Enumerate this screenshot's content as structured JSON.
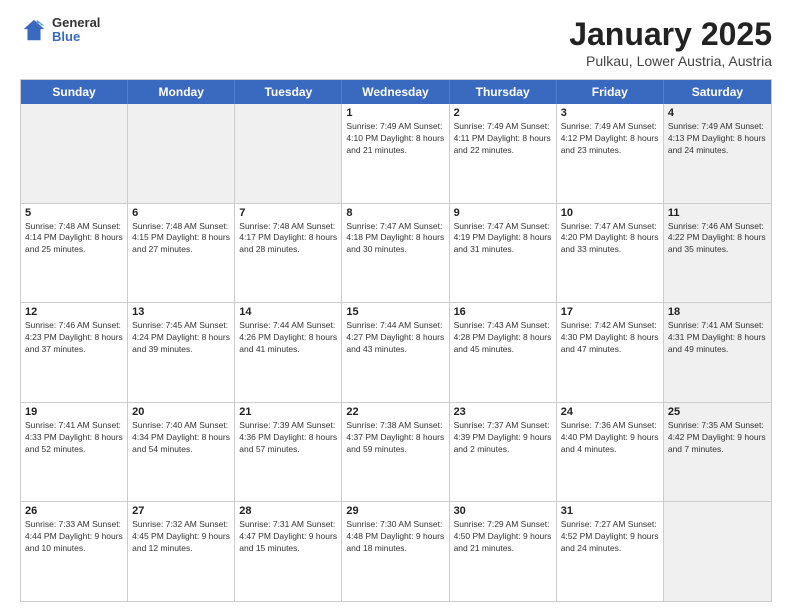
{
  "logo": {
    "general": "General",
    "blue": "Blue"
  },
  "title": "January 2025",
  "subtitle": "Pulkau, Lower Austria, Austria",
  "days_of_week": [
    "Sunday",
    "Monday",
    "Tuesday",
    "Wednesday",
    "Thursday",
    "Friday",
    "Saturday"
  ],
  "weeks": [
    [
      {
        "day": "",
        "info": "",
        "shaded": true
      },
      {
        "day": "",
        "info": "",
        "shaded": true
      },
      {
        "day": "",
        "info": "",
        "shaded": true
      },
      {
        "day": "1",
        "info": "Sunrise: 7:49 AM\nSunset: 4:10 PM\nDaylight: 8 hours\nand 21 minutes."
      },
      {
        "day": "2",
        "info": "Sunrise: 7:49 AM\nSunset: 4:11 PM\nDaylight: 8 hours\nand 22 minutes."
      },
      {
        "day": "3",
        "info": "Sunrise: 7:49 AM\nSunset: 4:12 PM\nDaylight: 8 hours\nand 23 minutes."
      },
      {
        "day": "4",
        "info": "Sunrise: 7:49 AM\nSunset: 4:13 PM\nDaylight: 8 hours\nand 24 minutes.",
        "shaded": true
      }
    ],
    [
      {
        "day": "5",
        "info": "Sunrise: 7:48 AM\nSunset: 4:14 PM\nDaylight: 8 hours\nand 25 minutes."
      },
      {
        "day": "6",
        "info": "Sunrise: 7:48 AM\nSunset: 4:15 PM\nDaylight: 8 hours\nand 27 minutes."
      },
      {
        "day": "7",
        "info": "Sunrise: 7:48 AM\nSunset: 4:17 PM\nDaylight: 8 hours\nand 28 minutes."
      },
      {
        "day": "8",
        "info": "Sunrise: 7:47 AM\nSunset: 4:18 PM\nDaylight: 8 hours\nand 30 minutes."
      },
      {
        "day": "9",
        "info": "Sunrise: 7:47 AM\nSunset: 4:19 PM\nDaylight: 8 hours\nand 31 minutes."
      },
      {
        "day": "10",
        "info": "Sunrise: 7:47 AM\nSunset: 4:20 PM\nDaylight: 8 hours\nand 33 minutes."
      },
      {
        "day": "11",
        "info": "Sunrise: 7:46 AM\nSunset: 4:22 PM\nDaylight: 8 hours\nand 35 minutes.",
        "shaded": true
      }
    ],
    [
      {
        "day": "12",
        "info": "Sunrise: 7:46 AM\nSunset: 4:23 PM\nDaylight: 8 hours\nand 37 minutes."
      },
      {
        "day": "13",
        "info": "Sunrise: 7:45 AM\nSunset: 4:24 PM\nDaylight: 8 hours\nand 39 minutes."
      },
      {
        "day": "14",
        "info": "Sunrise: 7:44 AM\nSunset: 4:26 PM\nDaylight: 8 hours\nand 41 minutes."
      },
      {
        "day": "15",
        "info": "Sunrise: 7:44 AM\nSunset: 4:27 PM\nDaylight: 8 hours\nand 43 minutes."
      },
      {
        "day": "16",
        "info": "Sunrise: 7:43 AM\nSunset: 4:28 PM\nDaylight: 8 hours\nand 45 minutes."
      },
      {
        "day": "17",
        "info": "Sunrise: 7:42 AM\nSunset: 4:30 PM\nDaylight: 8 hours\nand 47 minutes."
      },
      {
        "day": "18",
        "info": "Sunrise: 7:41 AM\nSunset: 4:31 PM\nDaylight: 8 hours\nand 49 minutes.",
        "shaded": true
      }
    ],
    [
      {
        "day": "19",
        "info": "Sunrise: 7:41 AM\nSunset: 4:33 PM\nDaylight: 8 hours\nand 52 minutes."
      },
      {
        "day": "20",
        "info": "Sunrise: 7:40 AM\nSunset: 4:34 PM\nDaylight: 8 hours\nand 54 minutes."
      },
      {
        "day": "21",
        "info": "Sunrise: 7:39 AM\nSunset: 4:36 PM\nDaylight: 8 hours\nand 57 minutes."
      },
      {
        "day": "22",
        "info": "Sunrise: 7:38 AM\nSunset: 4:37 PM\nDaylight: 8 hours\nand 59 minutes."
      },
      {
        "day": "23",
        "info": "Sunrise: 7:37 AM\nSunset: 4:39 PM\nDaylight: 9 hours\nand 2 minutes."
      },
      {
        "day": "24",
        "info": "Sunrise: 7:36 AM\nSunset: 4:40 PM\nDaylight: 9 hours\nand 4 minutes."
      },
      {
        "day": "25",
        "info": "Sunrise: 7:35 AM\nSunset: 4:42 PM\nDaylight: 9 hours\nand 7 minutes.",
        "shaded": true
      }
    ],
    [
      {
        "day": "26",
        "info": "Sunrise: 7:33 AM\nSunset: 4:44 PM\nDaylight: 9 hours\nand 10 minutes."
      },
      {
        "day": "27",
        "info": "Sunrise: 7:32 AM\nSunset: 4:45 PM\nDaylight: 9 hours\nand 12 minutes."
      },
      {
        "day": "28",
        "info": "Sunrise: 7:31 AM\nSunset: 4:47 PM\nDaylight: 9 hours\nand 15 minutes."
      },
      {
        "day": "29",
        "info": "Sunrise: 7:30 AM\nSunset: 4:48 PM\nDaylight: 9 hours\nand 18 minutes."
      },
      {
        "day": "30",
        "info": "Sunrise: 7:29 AM\nSunset: 4:50 PM\nDaylight: 9 hours\nand 21 minutes."
      },
      {
        "day": "31",
        "info": "Sunrise: 7:27 AM\nSunset: 4:52 PM\nDaylight: 9 hours\nand 24 minutes."
      },
      {
        "day": "",
        "info": "",
        "shaded": true
      }
    ]
  ]
}
